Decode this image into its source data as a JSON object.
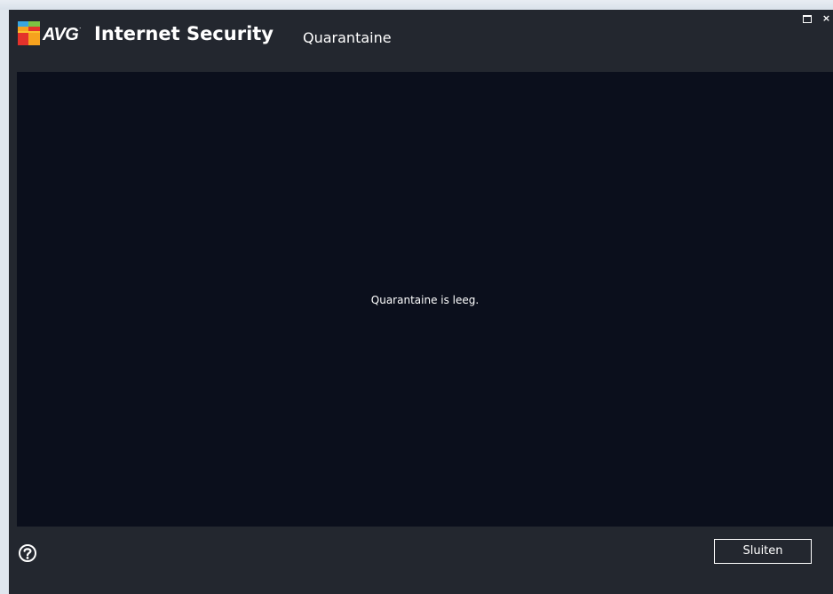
{
  "window": {
    "brand": "AVG",
    "product": "Internet Security",
    "dialog_title": "Quarantaine"
  },
  "controls": {
    "maximize_icon": "maximize-icon",
    "close_glyph": "×"
  },
  "content": {
    "empty_message": "Quarantaine is leeg."
  },
  "footer": {
    "help_icon": "help-icon",
    "close_label": "Sluiten"
  },
  "colors": {
    "window_bg": "#23272f",
    "panel_bg": "#0b0f1c",
    "text": "#ffffff"
  }
}
